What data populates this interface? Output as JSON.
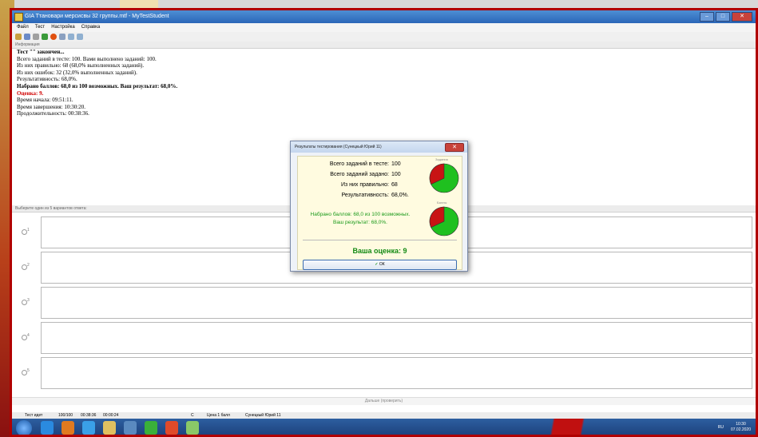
{
  "window": {
    "title": "GIA Ттановари мерсисвы 32 группы.mtf - MyTestStudent",
    "controls": [
      "–",
      "□",
      "✕"
    ]
  },
  "menu": [
    "Файл",
    "Тест",
    "Настройка",
    "Справка"
  ],
  "toolbar_icons": [
    "open-icon",
    "save-icon",
    "close-icon",
    "play-icon",
    "record-icon",
    "help-icon",
    "zoom-in-icon",
    "zoom-out-icon"
  ],
  "info_header": "Информация",
  "info_lines": {
    "l1": "Тест \"\" закончен...",
    "l2": "Всего заданий в тесте: 100. Вами выполнено заданий: 100.",
    "l3": "Из них правильно: 68 (68,0% выполненных заданий).",
    "l4": "Из них ошибок: 32 (32,0% выполненных заданий).",
    "l5": "Результативность: 68,0%.",
    "l6": "Набрано баллов: 68,0 из 100 возможных. Ваш результат: 68,0%.",
    "l7": "Оценка: 9.",
    "l8": "Время начала: 09:51:11.",
    "l9": "Время завершения: 10:30:20.",
    "l10": "Продолжительность: 00:38:36."
  },
  "answers_header": "Выберите один из 5 вариантов ответа:",
  "answers": [
    "1",
    "2",
    "3",
    "4",
    "5"
  ],
  "next_button": "Дальше (проверить)",
  "statusbar": {
    "state": "Тест идет",
    "progress": "100/100",
    "elapsed": "00:38:36",
    "task_time": "00:00:24",
    "mode": "С",
    "price": "Цена 1 балл",
    "user": "Сунецкый Юрий 11"
  },
  "dialog": {
    "title": "Результаты тестирования (Сунецкый Юрий 11)",
    "rows": [
      {
        "label": "Всего заданий в тесте:",
        "value": "100"
      },
      {
        "label": "Всего заданий задано:",
        "value": "100"
      },
      {
        "label": "Из них правильно:",
        "value": "68"
      },
      {
        "label": "Результативность:",
        "value": "68,0%."
      }
    ],
    "score_line1": "Набрано баллов: 68,0 из 100 возможных.",
    "score_line2": "Ваш результат: 68,0%.",
    "pie1_caption": "Задания",
    "pie2_caption": "Баллы",
    "pie_correct_fraction": 0.68,
    "grade": "Ваша оценка: 9",
    "ok_label": "ОК",
    "colors": {
      "correct": "#1fc01f",
      "wrong": "#c81414"
    }
  },
  "taskbar": {
    "apps": [
      "chrome-icon",
      "media-icon",
      "ie-icon",
      "explorer-icon",
      "network-icon",
      "player-icon",
      "chrome2-icon",
      "mytest-icon"
    ],
    "tray": "RU",
    "time": "10:30",
    "date": "07.02.2020"
  }
}
